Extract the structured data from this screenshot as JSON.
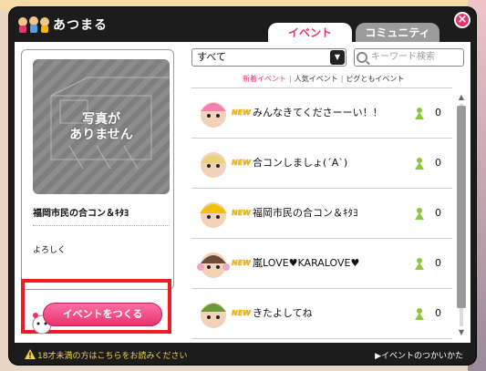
{
  "app": {
    "title": "あつまる"
  },
  "tabs": [
    {
      "label": "イベント",
      "active": true
    },
    {
      "label": "コミュニティ",
      "active": false
    }
  ],
  "close": {
    "label": "×"
  },
  "left": {
    "photo_placeholder": [
      "写真が",
      "ありません"
    ],
    "event_name": "福岡市民の合コン＆ｷﾀﾖ",
    "event_desc": "よろしく",
    "create_button": "イベントをつくる"
  },
  "filter": {
    "select_value": "すべて",
    "search_placeholder": "キーワード検索",
    "tabs": [
      "新着イベント",
      "人気イベント",
      "ピグともイベント"
    ],
    "separator": "|"
  },
  "events": [
    {
      "badge": "NEW",
      "title": "みんなきてくださーーい！！",
      "count": "0",
      "avatar": "avatar-pink-hat"
    },
    {
      "badge": "NEW",
      "title": "合コンしましょ(´A`)",
      "count": "0",
      "avatar": "avatar-blonde"
    },
    {
      "badge": "NEW",
      "title": "福岡市民の合コン＆ｷﾀﾖ",
      "count": "0",
      "avatar": "avatar-yellow-helmet"
    },
    {
      "badge": "NEW",
      "title": "嵐LOVE♥KARALOVE♥",
      "count": "0",
      "avatar": "avatar-earmuffs"
    },
    {
      "badge": "NEW",
      "title": "きたよしてね",
      "count": "0",
      "avatar": "avatar-green-hat"
    }
  ],
  "footer": {
    "warning": "18才未満の方はこちらをお読みください",
    "howto": "▶イベントのつかいかた"
  },
  "colors": {
    "accent": "#e8336e",
    "highlight_border": "#ee1b24",
    "window": "#1c1c1c",
    "count_icon": "#8cc63f"
  },
  "icons": {
    "close": "close-icon",
    "select": "chevron-down-icon",
    "search": "search-icon",
    "count": "people-icon",
    "warning": "warning-icon"
  }
}
